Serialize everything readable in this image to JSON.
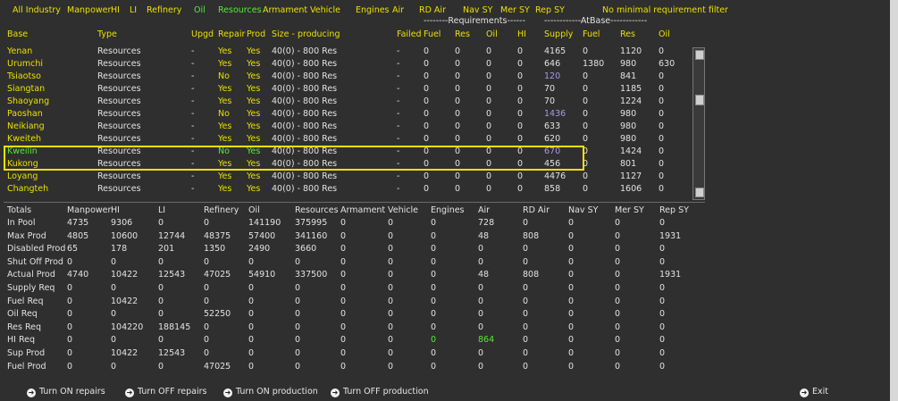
{
  "filters": [
    {
      "label": "All Industry",
      "color": "yel"
    },
    {
      "label": "Manpower",
      "color": "yel"
    },
    {
      "label": "HI",
      "color": "yel"
    },
    {
      "label": "LI",
      "color": "yel"
    },
    {
      "label": "Refinery",
      "color": "yel"
    },
    {
      "label": "Oil",
      "color": "grn"
    },
    {
      "label": "Resources",
      "color": "grn"
    },
    {
      "label": "Armament",
      "color": "yel"
    },
    {
      "label": "Vehicle",
      "color": "yel"
    },
    {
      "label": "Engines",
      "color": "yel"
    },
    {
      "label": "Air",
      "color": "yel"
    },
    {
      "label": "RD Air",
      "color": "yel"
    },
    {
      "label": "Nav SY",
      "color": "yel"
    },
    {
      "label": "Mer SY",
      "color": "yel"
    },
    {
      "label": "Rep SY",
      "color": "yel"
    },
    {
      "label": "No minimal requirement filter",
      "color": "yel"
    }
  ],
  "group_headers": {
    "requirements": "--------Requirements------",
    "atbase": "------------AtBase------------"
  },
  "columns": [
    "Base",
    "Type",
    "Upgd",
    "Repair",
    "Prod",
    "Size - producing",
    "Failed",
    "Fuel",
    "Res",
    "Oil",
    "HI",
    "Supply",
    "Fuel",
    "Res",
    "Oil"
  ],
  "rows": [
    {
      "name": "Yenan",
      "type": "Resources",
      "upgd": "-",
      "repair": "Yes",
      "prod": "Yes",
      "size": "40(0) - 800 Res",
      "failed": "-",
      "fuel": "0",
      "res": "0",
      "oil": "0",
      "hi": "0",
      "supply": "4165",
      "supply_color": "wht",
      "b_fuel": "0",
      "b_res": "1120",
      "b_oil": "0",
      "name_color": "yel"
    },
    {
      "name": "Urumchi",
      "type": "Resources",
      "upgd": "-",
      "repair": "Yes",
      "prod": "Yes",
      "size": "40(0) - 800 Res",
      "failed": "-",
      "fuel": "0",
      "res": "0",
      "oil": "0",
      "hi": "0",
      "supply": "646",
      "supply_color": "wht",
      "b_fuel": "1380",
      "b_res": "980",
      "b_oil": "630",
      "name_color": "yel"
    },
    {
      "name": "Tsiaotso",
      "type": "Resources",
      "upgd": "-",
      "repair": "No",
      "prod": "Yes",
      "size": "40(0) - 800 Res",
      "failed": "-",
      "fuel": "0",
      "res": "0",
      "oil": "0",
      "hi": "0",
      "supply": "120",
      "supply_color": "pur",
      "b_fuel": "0",
      "b_res": "841",
      "b_oil": "0",
      "name_color": "yel"
    },
    {
      "name": "Siangtan",
      "type": "Resources",
      "upgd": "-",
      "repair": "Yes",
      "prod": "Yes",
      "size": "40(0) - 800 Res",
      "failed": "-",
      "fuel": "0",
      "res": "0",
      "oil": "0",
      "hi": "0",
      "supply": "70",
      "supply_color": "wht",
      "b_fuel": "0",
      "b_res": "1185",
      "b_oil": "0",
      "name_color": "yel"
    },
    {
      "name": "Shaoyang",
      "type": "Resources",
      "upgd": "-",
      "repair": "Yes",
      "prod": "Yes",
      "size": "40(0) - 800 Res",
      "failed": "-",
      "fuel": "0",
      "res": "0",
      "oil": "0",
      "hi": "0",
      "supply": "70",
      "supply_color": "wht",
      "b_fuel": "0",
      "b_res": "1224",
      "b_oil": "0",
      "name_color": "yel"
    },
    {
      "name": "Paoshan",
      "type": "Resources",
      "upgd": "-",
      "repair": "No",
      "prod": "Yes",
      "size": "40(0) - 800 Res",
      "failed": "-",
      "fuel": "0",
      "res": "0",
      "oil": "0",
      "hi": "0",
      "supply": "1436",
      "supply_color": "pur",
      "b_fuel": "0",
      "b_res": "980",
      "b_oil": "0",
      "name_color": "yel"
    },
    {
      "name": "Neikiang",
      "type": "Resources",
      "upgd": "-",
      "repair": "Yes",
      "prod": "Yes",
      "size": "40(0) - 800 Res",
      "failed": "-",
      "fuel": "0",
      "res": "0",
      "oil": "0",
      "hi": "0",
      "supply": "633",
      "supply_color": "wht",
      "b_fuel": "0",
      "b_res": "980",
      "b_oil": "0",
      "name_color": "yel"
    },
    {
      "name": "Kweiteh",
      "type": "Resources",
      "upgd": "-",
      "repair": "Yes",
      "prod": "Yes",
      "size": "40(0) - 800 Res",
      "failed": "-",
      "fuel": "0",
      "res": "0",
      "oil": "0",
      "hi": "0",
      "supply": "620",
      "supply_color": "wht",
      "b_fuel": "0",
      "b_res": "980",
      "b_oil": "0",
      "name_color": "yel"
    },
    {
      "name": "Kweilin",
      "type": "Resources",
      "upgd": "-",
      "repair": "No",
      "prod": "Yes",
      "size": "40(0) - 800 Res",
      "failed": "-",
      "fuel": "0",
      "res": "0",
      "oil": "0",
      "hi": "0",
      "supply": "670",
      "supply_color": "pur",
      "b_fuel": "0",
      "b_res": "1424",
      "b_oil": "0",
      "name_color": "grn",
      "repair_color": "grn",
      "prod_color": "grn"
    },
    {
      "name": "Kukong",
      "type": "Resources",
      "upgd": "-",
      "repair": "Yes",
      "prod": "Yes",
      "size": "40(0) - 800 Res",
      "failed": "-",
      "fuel": "0",
      "res": "0",
      "oil": "0",
      "hi": "0",
      "supply": "456",
      "supply_color": "wht",
      "b_fuel": "0",
      "b_res": "801",
      "b_oil": "0",
      "name_color": "yel"
    },
    {
      "name": "Loyang",
      "type": "Resources",
      "upgd": "-",
      "repair": "Yes",
      "prod": "Yes",
      "size": "40(0) - 800 Res",
      "failed": "-",
      "fuel": "0",
      "res": "0",
      "oil": "0",
      "hi": "0",
      "supply": "4476",
      "supply_color": "wht",
      "b_fuel": "0",
      "b_res": "1127",
      "b_oil": "0",
      "name_color": "yel"
    },
    {
      "name": "Changteh",
      "type": "Resources",
      "upgd": "-",
      "repair": "Yes",
      "prod": "Yes",
      "size": "40(0) - 800 Res",
      "failed": "-",
      "fuel": "0",
      "res": "0",
      "oil": "0",
      "hi": "0",
      "supply": "858",
      "supply_color": "wht",
      "b_fuel": "0",
      "b_res": "1606",
      "b_oil": "0",
      "name_color": "yel"
    }
  ],
  "totals_headers": [
    "Totals",
    "Manpower",
    "HI",
    "LI",
    "Refinery",
    "Oil",
    "Resources",
    "Armament",
    "Vehicle",
    "Engines",
    "Air",
    "RD Air",
    "Nav SY",
    "Mer SY",
    "Rep SY"
  ],
  "totals": [
    {
      "label": "In Pool",
      "values": [
        "4735",
        "9306",
        "0",
        "0",
        "141190",
        "375995",
        "0",
        "0",
        "0",
        "728",
        "0",
        "0",
        "0",
        "0"
      ]
    },
    {
      "label": "Max Prod",
      "values": [
        "4805",
        "10600",
        "12744",
        "48375",
        "57400",
        "341160",
        "0",
        "0",
        "0",
        "48",
        "808",
        "0",
        "0",
        "1931"
      ]
    },
    {
      "label": "Disabled Prod",
      "values": [
        "65",
        "178",
        "201",
        "1350",
        "2490",
        "3660",
        "0",
        "0",
        "0",
        "0",
        "0",
        "0",
        "0",
        "0"
      ]
    },
    {
      "label": "Shut Off Prod",
      "values": [
        "0",
        "0",
        "0",
        "0",
        "0",
        "0",
        "0",
        "0",
        "0",
        "0",
        "0",
        "0",
        "0",
        "0"
      ]
    },
    {
      "label": "Actual Prod",
      "values": [
        "4740",
        "10422",
        "12543",
        "47025",
        "54910",
        "337500",
        "0",
        "0",
        "0",
        "48",
        "808",
        "0",
        "0",
        "1931"
      ]
    },
    {
      "label": "Supply Req",
      "values": [
        "0",
        "0",
        "0",
        "0",
        "0",
        "0",
        "0",
        "0",
        "0",
        "0",
        "0",
        "0",
        "0",
        "0"
      ]
    },
    {
      "label": "Fuel Req",
      "values": [
        "0",
        "10422",
        "0",
        "0",
        "0",
        "0",
        "0",
        "0",
        "0",
        "0",
        "0",
        "0",
        "0",
        "0"
      ]
    },
    {
      "label": "Oil Req",
      "values": [
        "0",
        "0",
        "0",
        "52250",
        "0",
        "0",
        "0",
        "0",
        "0",
        "0",
        "0",
        "0",
        "0",
        "0"
      ]
    },
    {
      "label": "Res Req",
      "values": [
        "0",
        "104220",
        "188145",
        "0",
        "0",
        "0",
        "0",
        "0",
        "0",
        "0",
        "0",
        "0",
        "0",
        "0"
      ]
    },
    {
      "label": "HI Req",
      "values": [
        "0",
        "0",
        "0",
        "0",
        "0",
        "0",
        "0",
        "0",
        "0",
        "864",
        "0",
        "0",
        "0",
        "0"
      ]
    },
    {
      "label": "Sup Prod",
      "values": [
        "0",
        "10422",
        "12543",
        "0",
        "0",
        "0",
        "0",
        "0",
        "0",
        "0",
        "0",
        "0",
        "0",
        "0"
      ]
    },
    {
      "label": "Fuel Prod",
      "values": [
        "0",
        "0",
        "0",
        "47025",
        "0",
        "0",
        "0",
        "0",
        "0",
        "0",
        "0",
        "0",
        "0",
        "0"
      ]
    }
  ],
  "totals_green": {
    "row": 9,
    "cols": [
      8,
      9
    ]
  },
  "buttons": [
    {
      "label": "Turn ON repairs",
      "name": "turn-on-repairs-button"
    },
    {
      "label": "Turn OFF repairs",
      "name": "turn-off-repairs-button"
    },
    {
      "label": "Turn ON production",
      "name": "turn-on-production-button"
    },
    {
      "label": "Turn OFF production",
      "name": "turn-off-production-button"
    }
  ],
  "exit_label": "Exit",
  "icon_names": {
    "button_icon": "arrow-circle-icon",
    "scroll": "scrollbar"
  }
}
